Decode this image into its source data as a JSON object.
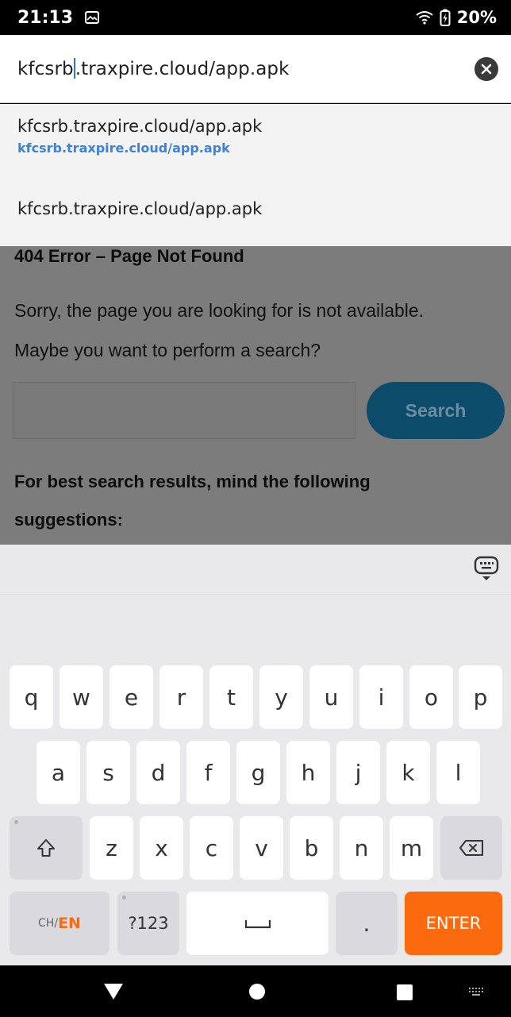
{
  "status_bar": {
    "time": "21:13",
    "battery_percent": "20%",
    "icons": [
      "photo-notification-icon",
      "wifi-icon",
      "battery-charging-icon"
    ]
  },
  "url_bar": {
    "url_before_caret": "kfcsrb",
    "url_after_caret": ".traxpire.cloud/app.apk",
    "clear_icon": "close-icon"
  },
  "suggestions": {
    "items": [
      {
        "title": "kfcsrb.traxpire.cloud/app.apk",
        "url": "kfcsrb.traxpire.cloud/app.apk"
      },
      {
        "title": "kfcsrb.traxpire.cloud/app.apk"
      }
    ]
  },
  "page": {
    "title": "404 Error – Page Not Found",
    "message_line1": "Sorry, the page you are looking for is not available.",
    "message_line2": "Maybe you want to perform a search?",
    "search_button": "Search",
    "hint": "For best search results, mind the following suggestions:"
  },
  "keyboard": {
    "row1": [
      "q",
      "w",
      "e",
      "r",
      "t",
      "y",
      "u",
      "i",
      "o",
      "p"
    ],
    "row2": [
      "a",
      "s",
      "d",
      "f",
      "g",
      "h",
      "j",
      "k",
      "l"
    ],
    "row3": [
      "z",
      "x",
      "c",
      "v",
      "b",
      "n",
      "m"
    ],
    "lang_ch": "CH/",
    "lang_en": "EN",
    "symbols": "?123",
    "period": ".",
    "enter": "ENTER",
    "hide_icon": "keyboard-hide-icon",
    "shift_icon": "shift-icon",
    "backspace_icon": "backspace-icon",
    "space_icon": "space-icon"
  },
  "nav_bar": {
    "icons": [
      "back-triangle-icon",
      "home-circle-icon",
      "recents-square-icon",
      "keyboard-switch-icon"
    ]
  },
  "colors": {
    "accent_link": "#3b82e0",
    "enter_key": "#fb6a0e",
    "search_button": "#0d4b6a",
    "page_dim": "#7c7c7c"
  }
}
